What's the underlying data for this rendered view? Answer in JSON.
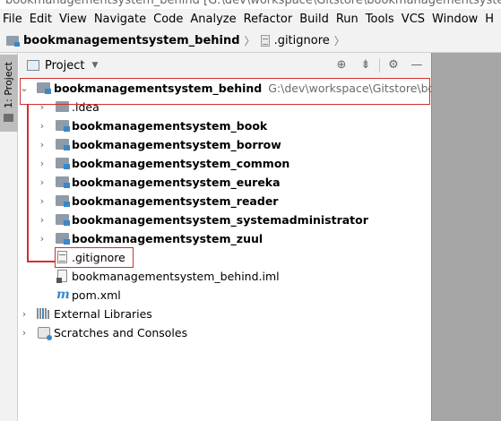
{
  "window": {
    "title": "bookmanagementsystem_behind [G:\\dev\\workspace\\Gitstore\\bookmanagementsystem_behind]"
  },
  "menubar": {
    "items": [
      "File",
      "Edit",
      "View",
      "Navigate",
      "Code",
      "Analyze",
      "Refactor",
      "Build",
      "Run",
      "Tools",
      "VCS",
      "Window",
      "H"
    ]
  },
  "navbar": {
    "crumbs": [
      "bookmanagementsystem_behind",
      ".gitignore"
    ]
  },
  "sidebar": {
    "tab_label": "1: Project"
  },
  "panel": {
    "title": "Project",
    "tools": [
      "locate-icon",
      "collapse-icon",
      "gear-icon",
      "minimize-icon"
    ]
  },
  "tree": {
    "root": {
      "label": "bookmanagementsystem_behind",
      "path": "G:\\dev\\workspace\\Gitstore\\bookma"
    },
    "children": [
      ".idea",
      "bookmanagementsystem_book",
      "bookmanagementsystem_borrow",
      "bookmanagementsystem_common",
      "bookmanagementsystem_eureka",
      "bookmanagementsystem_reader",
      "bookmanagementsystem_systemadministrator",
      "bookmanagementsystem_zuul"
    ],
    "files": [
      ".gitignore",
      "bookmanagementsystem_behind.iml",
      "pom.xml"
    ],
    "external_libraries": "External Libraries",
    "scratches": "Scratches and Consoles"
  },
  "colors": {
    "highlight": "#d0312d",
    "module_badge": "#3a88c9",
    "chrome": "#f2f2f2",
    "editor_bg": "#a6a6a6"
  }
}
